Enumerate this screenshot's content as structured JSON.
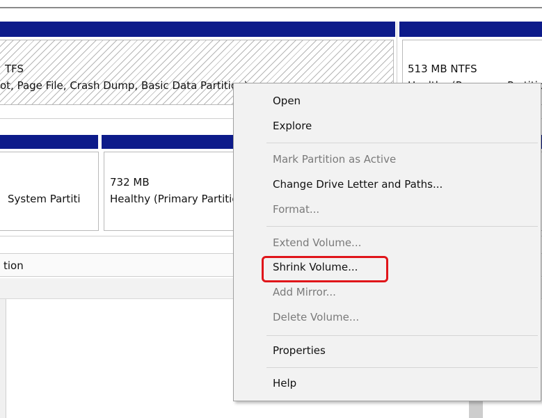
{
  "disk_view": {
    "row1": {
      "main_partition": {
        "line1": "TFS",
        "line2": "ot, Page File, Crash Dump, Basic Data Partition)"
      },
      "right_partition": {
        "line1": "513 MB NTFS",
        "line2": "Healthy (Recovery Partition)"
      }
    },
    "row2": {
      "left_partition": {
        "label": "System Partiti"
      },
      "mid_partition": {
        "size": "732 MB",
        "status": "Healthy (Primary Partition)"
      }
    },
    "list_header": {
      "column": "tion"
    }
  },
  "context_menu": {
    "items": [
      {
        "label": "Open",
        "enabled": true
      },
      {
        "label": "Explore",
        "enabled": true
      },
      {
        "label": "Mark Partition as Active",
        "enabled": false
      },
      {
        "label": "Change Drive Letter and Paths...",
        "enabled": true
      },
      {
        "label": "Format...",
        "enabled": false
      },
      {
        "label": "Extend Volume...",
        "enabled": false
      },
      {
        "label": "Shrink Volume...",
        "enabled": true
      },
      {
        "label": "Add Mirror...",
        "enabled": false
      },
      {
        "label": "Delete Volume...",
        "enabled": false
      },
      {
        "label": "Properties",
        "enabled": true
      },
      {
        "label": "Help",
        "enabled": true
      }
    ]
  },
  "colors": {
    "disk_bar": "#0d1b8a",
    "highlight": "#e0151a",
    "menu_background": "#f2f2f2"
  }
}
